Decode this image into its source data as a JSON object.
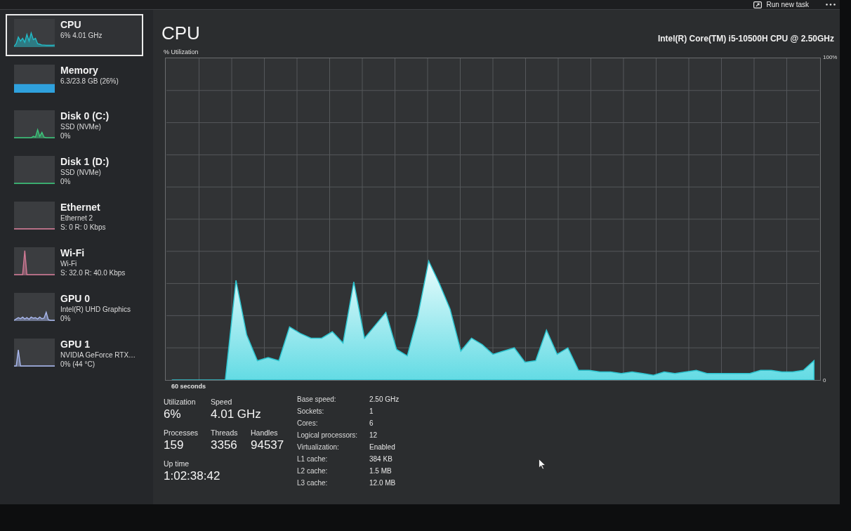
{
  "toolbar": {
    "run_new_task": "Run new task"
  },
  "sidebar": {
    "items": [
      {
        "title": "CPU",
        "details": [
          "6% 4.01 GHz"
        ],
        "kind": "cpu",
        "selected": true
      },
      {
        "title": "Memory",
        "details": [
          "6.3/23.8 GB (26%)"
        ],
        "kind": "memory",
        "selected": false
      },
      {
        "title": "Disk 0 (C:)",
        "details": [
          "SSD (NVMe)",
          "0%"
        ],
        "kind": "disk",
        "selected": false
      },
      {
        "title": "Disk 1 (D:)",
        "details": [
          "SSD (NVMe)",
          "0%"
        ],
        "kind": "disk",
        "selected": false
      },
      {
        "title": "Ethernet",
        "details": [
          "Ethernet 2",
          "S: 0 R: 0 Kbps"
        ],
        "kind": "network",
        "selected": false
      },
      {
        "title": "Wi-Fi",
        "details": [
          "Wi-Fi",
          "S: 32.0 R: 40.0 Kbps"
        ],
        "kind": "network",
        "selected": false
      },
      {
        "title": "GPU 0",
        "details": [
          "Intel(R) UHD Graphics",
          "0%"
        ],
        "kind": "gpu",
        "selected": false
      },
      {
        "title": "GPU 1",
        "details": [
          "NVIDIA GeForce RTX…",
          "0% (44 °C)"
        ],
        "kind": "gpu",
        "selected": false
      }
    ]
  },
  "main": {
    "title": "CPU",
    "processor": "Intel(R) Core(TM) i5-10500H CPU @ 2.50GHz",
    "chart_data": {
      "type": "area",
      "ylabel": "% Utilization",
      "xlabel": "60 seconds",
      "grid": true,
      "ylim": [
        0,
        100
      ],
      "yticks": [
        {
          "value": 100,
          "label": "100%"
        },
        {
          "value": 0,
          "label": "0"
        }
      ],
      "categories": [
        null,
        null,
        null,
        null,
        null,
        null,
        null,
        null,
        null,
        null,
        null,
        null,
        null,
        null,
        null,
        null,
        null,
        null,
        null,
        null,
        null,
        null,
        null,
        null,
        null,
        null,
        null,
        null,
        null,
        null,
        null,
        null,
        null,
        null,
        null,
        null,
        null,
        null,
        null,
        null,
        null,
        null,
        null,
        null,
        null,
        null,
        null,
        null,
        null,
        null,
        null,
        null,
        null,
        null,
        null,
        null,
        null,
        null,
        null,
        null,
        null
      ],
      "values": [
        0,
        0,
        0,
        0,
        0,
        0,
        31,
        14,
        6,
        7,
        6,
        16.5,
        14.5,
        13,
        13,
        15,
        11.5,
        30.5,
        13,
        17,
        21,
        9.5,
        7.5,
        20,
        37,
        30,
        22,
        9,
        13,
        11,
        8,
        9,
        10,
        5.5,
        6,
        15.5,
        8,
        10,
        3,
        3,
        2.5,
        2.5,
        2,
        2.5,
        2,
        1.5,
        2.5,
        2,
        2.5,
        3,
        2,
        2,
        2,
        2,
        2,
        3,
        3,
        2.5,
        2.5,
        3,
        6
      ]
    },
    "stats": [
      {
        "items": [
          {
            "label": "Utilization",
            "value": "6%"
          },
          {
            "label": "Speed",
            "value": "4.01 GHz"
          }
        ]
      },
      {
        "items": [
          {
            "label": "Processes",
            "value": "159"
          },
          {
            "label": "Threads",
            "value": "3356"
          },
          {
            "label": "Handles",
            "value": "94537"
          }
        ]
      },
      {
        "items": [
          {
            "label": "Up time",
            "value": "1:02:38:42"
          }
        ]
      }
    ],
    "specs": [
      {
        "label": "Base speed:",
        "value": "2.50 GHz"
      },
      {
        "label": "Sockets:",
        "value": "1"
      },
      {
        "label": "Cores:",
        "value": "6"
      },
      {
        "label": "Logical processors:",
        "value": "12"
      },
      {
        "label": "Virtualization:",
        "value": "Enabled"
      },
      {
        "label": "L1 cache:",
        "value": "384 KB"
      },
      {
        "label": "L2 cache:",
        "value": "1.5 MB"
      },
      {
        "label": "L3 cache:",
        "value": "12.0 MB"
      }
    ]
  }
}
